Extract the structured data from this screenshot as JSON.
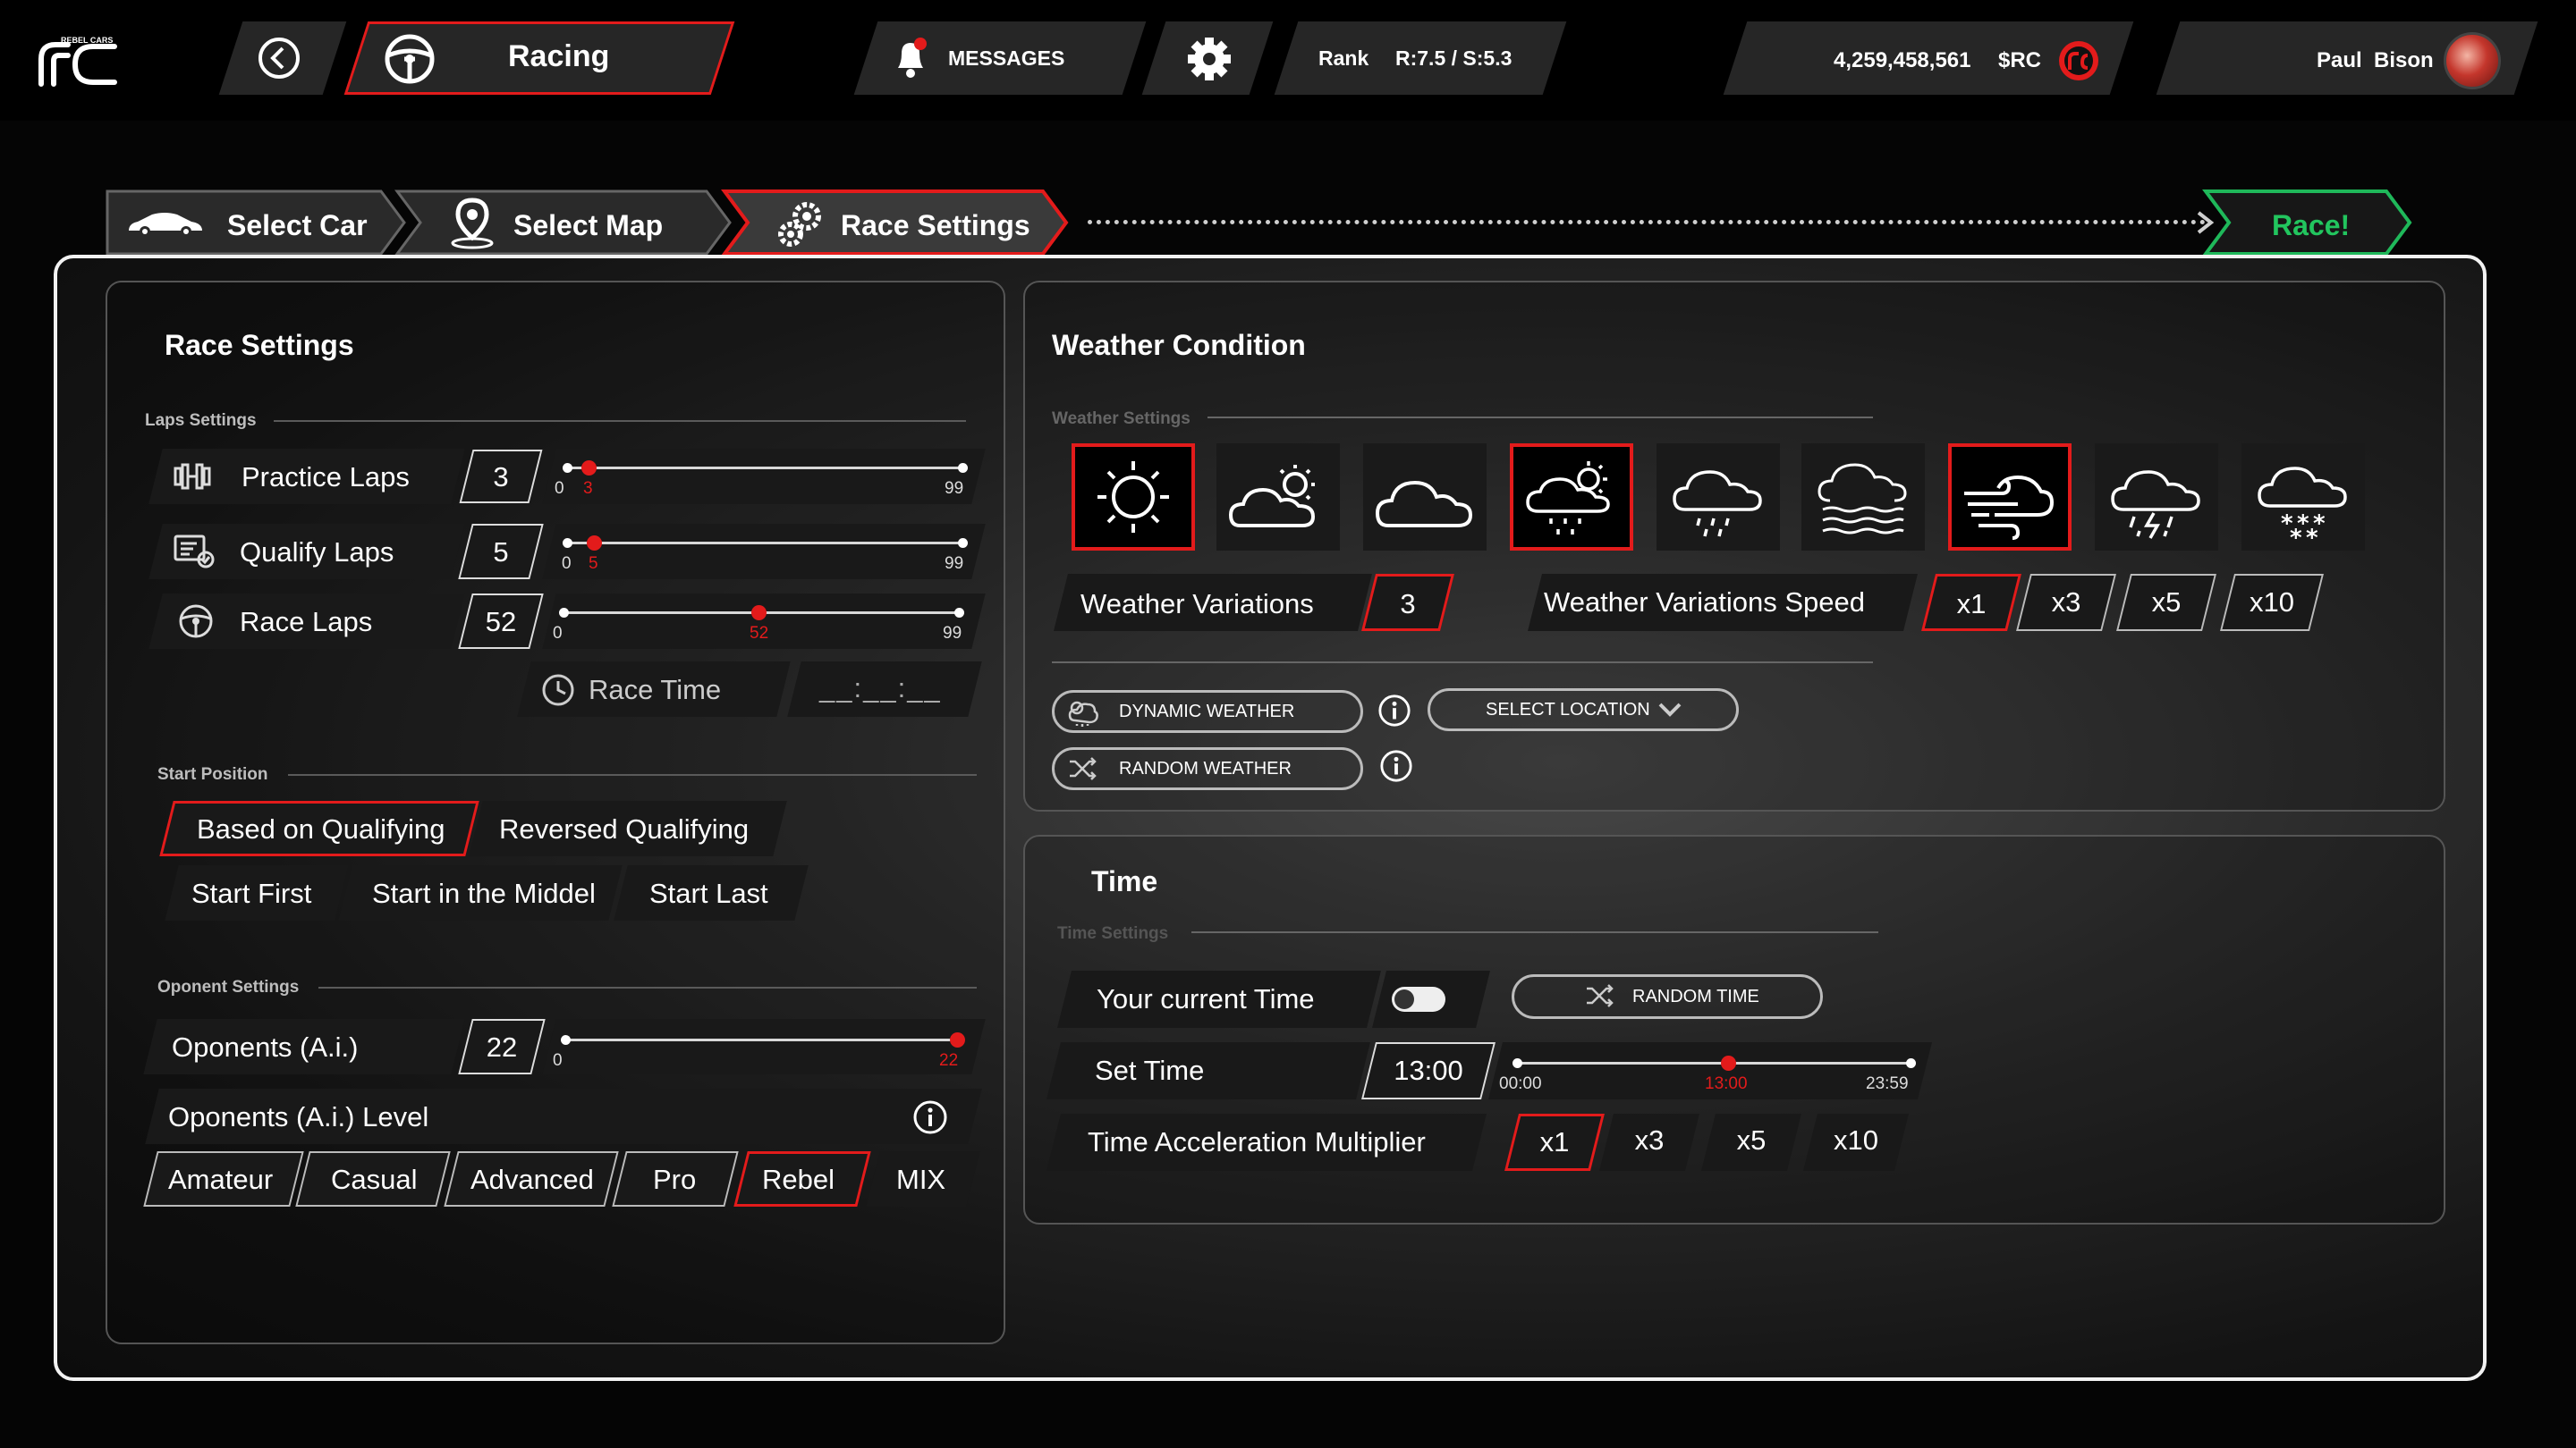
{
  "header": {
    "brand_tag": "REBEL CARS",
    "title": "Racing",
    "messages_label": "MESSAGES",
    "rank_label": "Rank",
    "rank_value": "R:7.5 / S:5.3",
    "balance": "4,259,458,561",
    "currency": "$RC",
    "user_name": "Paul  Bison",
    "accent": "#e31b1b"
  },
  "steps": [
    {
      "label": "Select Car"
    },
    {
      "label": "Select Map"
    },
    {
      "label": "Race Settings"
    },
    {
      "label": "Race!"
    }
  ],
  "race_settings": {
    "title": "Race Settings",
    "laps_section": "Laps Settings",
    "laps": [
      {
        "label": "Practice Laps",
        "value": "3",
        "min": "0",
        "max": "99",
        "current": "3",
        "fraction": 0.03
      },
      {
        "label": "Qualify Laps",
        "value": "5",
        "min": "0",
        "max": "99",
        "current": "5",
        "fraction": 0.05
      },
      {
        "label": "Race Laps",
        "value": "52",
        "min": "0",
        "max": "99",
        "current": "52",
        "fraction": 0.525
      }
    ],
    "race_time_label": "Race Time",
    "race_time_value": "__:__:__",
    "start_section": "Start Position",
    "start_options": [
      "Based on Qualifying",
      "Reversed Qualifying",
      "Start First",
      "Start in the Middel",
      "Start Last"
    ],
    "start_selected": "Based on Qualifying",
    "opponent_section": "Oponent Settings",
    "opponents_label": "Oponents (A.i.)",
    "opponents_value": "22",
    "opponents_min": "0",
    "opponents_max": "22",
    "opponents_fraction": 1.0,
    "level_label": "Oponents (A.i.) Level",
    "levels": [
      "Amateur",
      "Casual",
      "Advanced",
      "Pro",
      "Rebel",
      "MIX"
    ],
    "level_selected": "Rebel"
  },
  "weather": {
    "title": "Weather Condition",
    "section": "Weather Settings",
    "icons": [
      {
        "name": "sun-icon",
        "selected": true
      },
      {
        "name": "partly-cloudy-icon",
        "selected": false
      },
      {
        "name": "cloud-icon",
        "selected": false
      },
      {
        "name": "sun-rain-icon",
        "selected": true
      },
      {
        "name": "rain-icon",
        "selected": false
      },
      {
        "name": "fog-icon",
        "selected": false
      },
      {
        "name": "wind-icon",
        "selected": true
      },
      {
        "name": "storm-icon",
        "selected": false
      },
      {
        "name": "snow-icon",
        "selected": false
      }
    ],
    "variations_label": "Weather Variations",
    "variations_value": "3",
    "speed_label": "Weather Variations Speed",
    "speeds": [
      "x1",
      "x3",
      "x5",
      "x10"
    ],
    "speed_selected": "x1",
    "dynamic_label": "DYNAMIC WEATHER",
    "location_label": "SELECT LOCATION",
    "random_label": "RANDOM WEATHER"
  },
  "time": {
    "title": "Time",
    "section": "Time Settings",
    "current_label": "Your current Time",
    "random_label": "RANDOM TIME",
    "set_label": "Set Time",
    "set_value": "13:00",
    "min": "00:00",
    "mid": "13:00",
    "max": "23:59",
    "fraction": 0.542,
    "accel_label": "Time Acceleration Multiplier",
    "accel": [
      "x1",
      "x3",
      "x5",
      "x10"
    ],
    "accel_selected": "x1"
  }
}
